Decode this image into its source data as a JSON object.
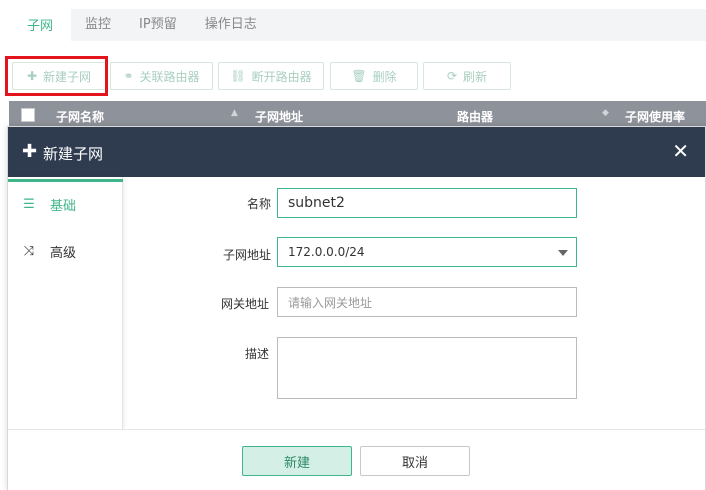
{
  "tabs": [
    {
      "label": "子网",
      "active": true
    },
    {
      "label": "监控",
      "active": false
    },
    {
      "label": "IP预留",
      "active": false
    },
    {
      "label": "操作日志",
      "active": false
    }
  ],
  "toolbar": {
    "new_subnet": "新建子网",
    "attach_router": "关联路由器",
    "detach_router": "断开路由器",
    "delete": "删除",
    "refresh": "刷新"
  },
  "table": {
    "columns": [
      "子网名称",
      "子网地址",
      "路由器",
      "子网使用率"
    ]
  },
  "modal": {
    "title": "新建子网",
    "sidebar": [
      {
        "label": "基础",
        "icon": "list-icon",
        "active": true
      },
      {
        "label": "高级",
        "icon": "shuffle-icon",
        "active": false
      }
    ],
    "form": {
      "name_label": "名称",
      "name_value": "subnet2",
      "cidr_label": "子网地址",
      "cidr_value": "172.0.0.0/24",
      "gateway_label": "网关地址",
      "gateway_placeholder": "请输入网关地址",
      "desc_label": "描述",
      "required_mark": "*"
    },
    "buttons": {
      "create": "新建",
      "cancel": "取消"
    }
  },
  "colors": {
    "accent": "#3fb68a",
    "header_bg": "#2f3b4f",
    "highlight_box": "#e3141b"
  }
}
